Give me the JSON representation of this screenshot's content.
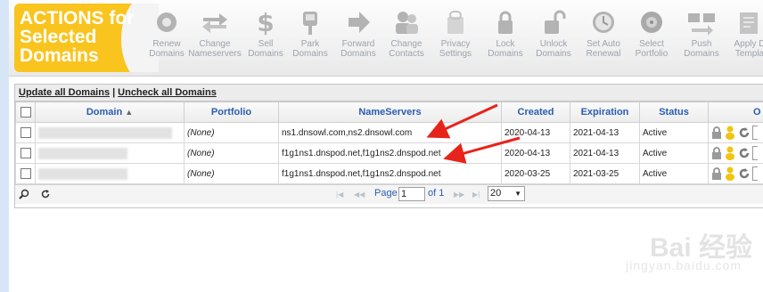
{
  "actions_title": "ACTIONS for\nSelected\nDomains",
  "toolbar": [
    {
      "label": "Renew\nDomains",
      "icon": "renew-icon"
    },
    {
      "label": "Change\nNameservers",
      "icon": "arrows-exchange-icon"
    },
    {
      "label": "Sell\nDomains",
      "icon": "dollar-icon"
    },
    {
      "label": "Park\nDomains",
      "icon": "parking-meter-icon"
    },
    {
      "label": "Forward\nDomains",
      "icon": "forward-arrow-icon"
    },
    {
      "label": "Change\nContacts",
      "icon": "contacts-icon"
    },
    {
      "label": "Privacy\nSettings",
      "icon": "privacy-icon"
    },
    {
      "label": "Lock\nDomains",
      "icon": "lock-icon"
    },
    {
      "label": "Unlock\nDomains",
      "icon": "unlock-icon"
    },
    {
      "label": "Set Auto\nRenewal",
      "icon": "clock-icon"
    },
    {
      "label": "Select\nPortfolio",
      "icon": "portfolio-disc-icon"
    },
    {
      "label": "Push\nDomains",
      "icon": "push-icon"
    },
    {
      "label": "Apply D\nTempla",
      "icon": "apply-template-icon"
    }
  ],
  "links": {
    "update_all": "Update all Domains",
    "separator": "|",
    "uncheck_all": "Uncheck all Domains"
  },
  "columns": {
    "domain": "Domain",
    "portfolio": "Portfolio",
    "nameservers": "NameServers",
    "created": "Created",
    "expiration": "Expiration",
    "status": "Status",
    "options": "O"
  },
  "rows": [
    {
      "portfolio": "(None)",
      "nameservers": "ns1.dnsowl.com,ns2.dnsowl.com",
      "created": "2020-04-13",
      "expiration": "2021-04-13",
      "status": "Active"
    },
    {
      "portfolio": "(None)",
      "nameservers": "f1g1ns1.dnspod.net,f1g1ns2.dnspod.net",
      "created": "2020-04-13",
      "expiration": "2021-04-13",
      "status": "Active"
    },
    {
      "portfolio": "(None)",
      "nameservers": "f1g1ns1.dnspod.net,f1g1ns2.dnspod.net",
      "created": "2020-03-25",
      "expiration": "2021-03-25",
      "status": "Active"
    }
  ],
  "pager": {
    "page_label": "Page",
    "page_value": "1",
    "of_label": "of 1",
    "rows_per_page": "20"
  },
  "watermark": {
    "main": "Bai 经验",
    "sub": "jingyan.baidu.com"
  },
  "colors": {
    "accent": "#f9c41e",
    "link": "#2a5db0",
    "arrow": "#e8231b"
  }
}
